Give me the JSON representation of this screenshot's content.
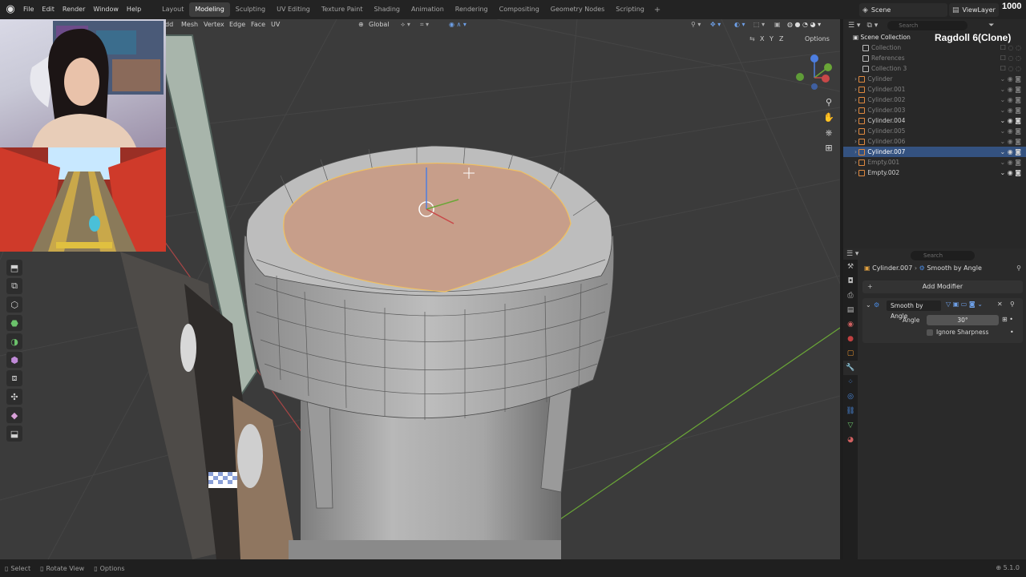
{
  "menu": {
    "items": [
      "File",
      "Edit",
      "Render",
      "Window",
      "Help"
    ],
    "workspaces": [
      "Layout",
      "Modeling",
      "Sculpting",
      "UV Editing",
      "Texture Paint",
      "Shading",
      "Animation",
      "Rendering",
      "Compositing",
      "Geometry Nodes",
      "Scripting"
    ],
    "active_workspace": "Modeling",
    "add_tab": "+",
    "scene": "Scene",
    "view_layer": "ViewLayer",
    "count": "1000"
  },
  "viewport": {
    "header": {
      "select_mode_items": [
        "dd",
        "Mesh",
        "Vertex",
        "Edge",
        "Face",
        "UV"
      ],
      "orientation": "Global",
      "options": "Options",
      "axes": [
        "X",
        "Y",
        "Z"
      ]
    },
    "colors": {
      "background": "#3b3b3b",
      "mesh": "#a9a9a9",
      "selected_face": "#c79e8a",
      "selection_edge": "#f0c060",
      "x_axis": "#b64a4a",
      "y_axis": "#6ea93a"
    }
  },
  "outliner": {
    "title": "Scene Collection",
    "search_placeholder": "Search",
    "rows": [
      {
        "label": "Collection",
        "state": "dim"
      },
      {
        "label": "References",
        "state": "dim"
      },
      {
        "label": "Collection 3",
        "state": "dim"
      },
      {
        "label": "Cylinder",
        "state": "dim"
      },
      {
        "label": "Cylinder.001",
        "state": "dim"
      },
      {
        "label": "Cylinder.002",
        "state": "dim"
      },
      {
        "label": "Cylinder.003",
        "state": "dim"
      },
      {
        "label": "Cylinder.004",
        "state": "normal"
      },
      {
        "label": "Cylinder.005",
        "state": "dim"
      },
      {
        "label": "Cylinder.006",
        "state": "dim"
      },
      {
        "label": "Cylinder.007",
        "state": "selected"
      },
      {
        "label": "Empty.001",
        "state": "dim"
      },
      {
        "label": "Empty.002",
        "state": "normal"
      }
    ],
    "overlay_label": "Ragdoll 6(Clone)"
  },
  "properties": {
    "search_placeholder": "Search",
    "object_name": "Cylinder.007",
    "modifier_crumb": "Smooth by Angle",
    "add_modifier": "Add Modifier",
    "modifier": {
      "name": "Smooth by Angle",
      "angle_label": "Angle",
      "angle_value": "30°",
      "ignore_sharpness_label": "Ignore Sharpness",
      "ignore_sharpness": false
    }
  },
  "status": {
    "items": [
      "Select",
      "Rotate View",
      "Options"
    ],
    "version": "5.1.0"
  }
}
